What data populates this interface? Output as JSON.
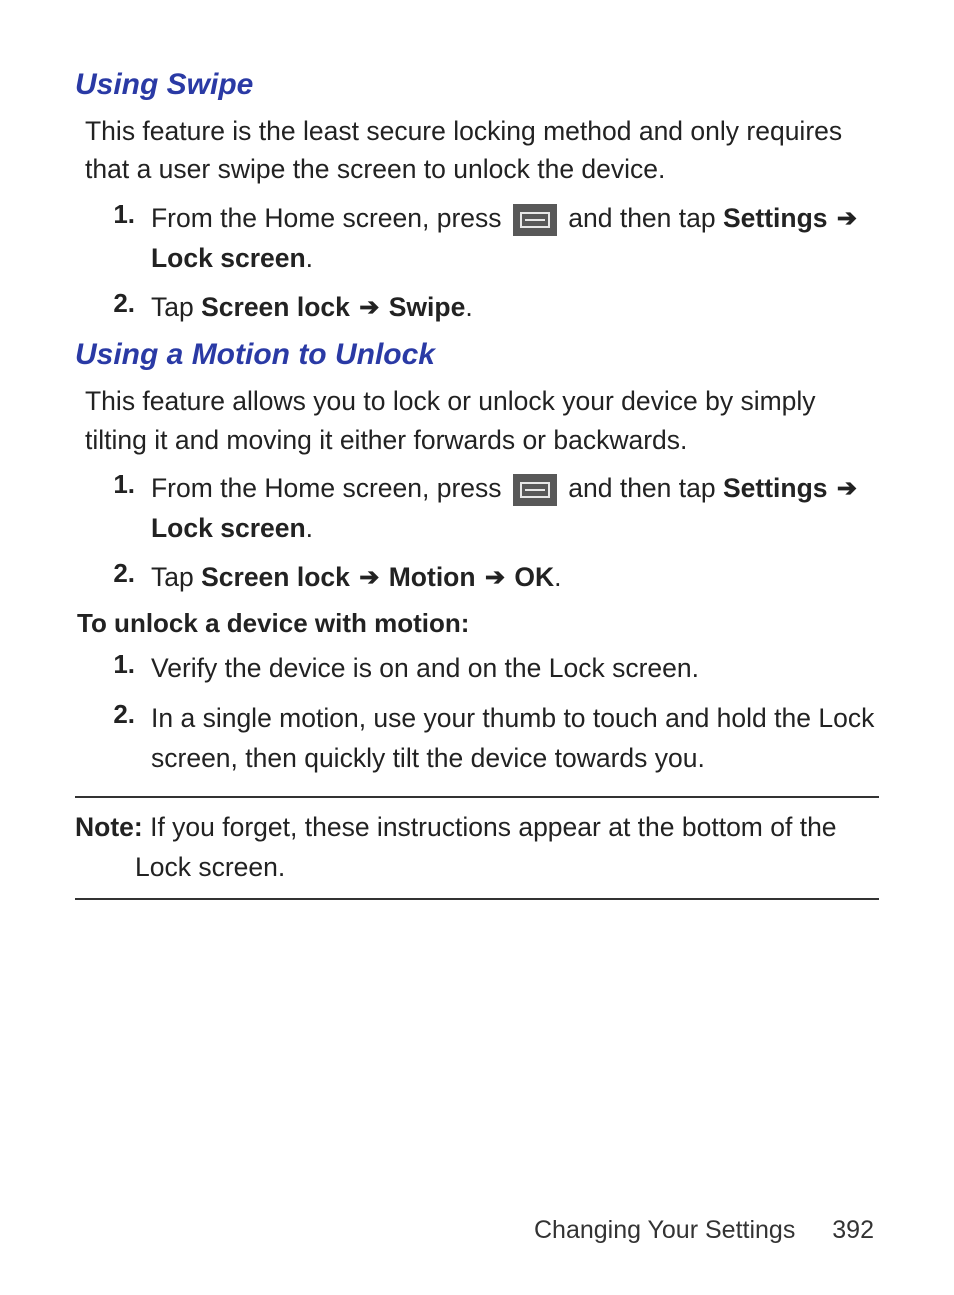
{
  "section1": {
    "heading": "Using Swipe",
    "intro": "This feature is the least secure locking method and only requires that a user swipe the screen to unlock the device.",
    "steps": [
      {
        "num": "1.",
        "pre": "From the Home screen, press ",
        "post_a": " and then tap ",
        "b1": "Settings",
        "arrow1": "➔",
        "b2": "Lock screen",
        "period": "."
      },
      {
        "num": "2.",
        "pre": "Tap ",
        "b1": "Screen lock",
        "arrow1": "➔",
        "b2": "Swipe",
        "period": "."
      }
    ]
  },
  "section2": {
    "heading": "Using a Motion to Unlock",
    "intro": "This feature allows you to lock or unlock your device by simply tilting it and moving it either forwards or backwards.",
    "steps": [
      {
        "num": "1.",
        "pre": "From the Home screen, press ",
        "post_a": " and then tap ",
        "b1": "Settings",
        "arrow1": "➔",
        "b2": "Lock screen",
        "period": "."
      },
      {
        "num": "2.",
        "pre": "Tap ",
        "b1": "Screen lock",
        "arrow1": "➔",
        "b2": "Motion",
        "arrow2": "➔",
        "b3": "OK",
        "period": "."
      }
    ],
    "subheading": "To unlock a device with motion:",
    "substeps": [
      {
        "num": "1.",
        "text": "Verify the device is on and on the Lock screen."
      },
      {
        "num": "2.",
        "text": "In a single motion, use your thumb to touch and hold the Lock screen, then quickly tilt the device towards you."
      }
    ]
  },
  "note": {
    "label": "Note:",
    "text": " If you forget, these instructions appear at the bottom of the Lock screen."
  },
  "footer": {
    "chapter": "Changing Your Settings",
    "page": "392"
  }
}
